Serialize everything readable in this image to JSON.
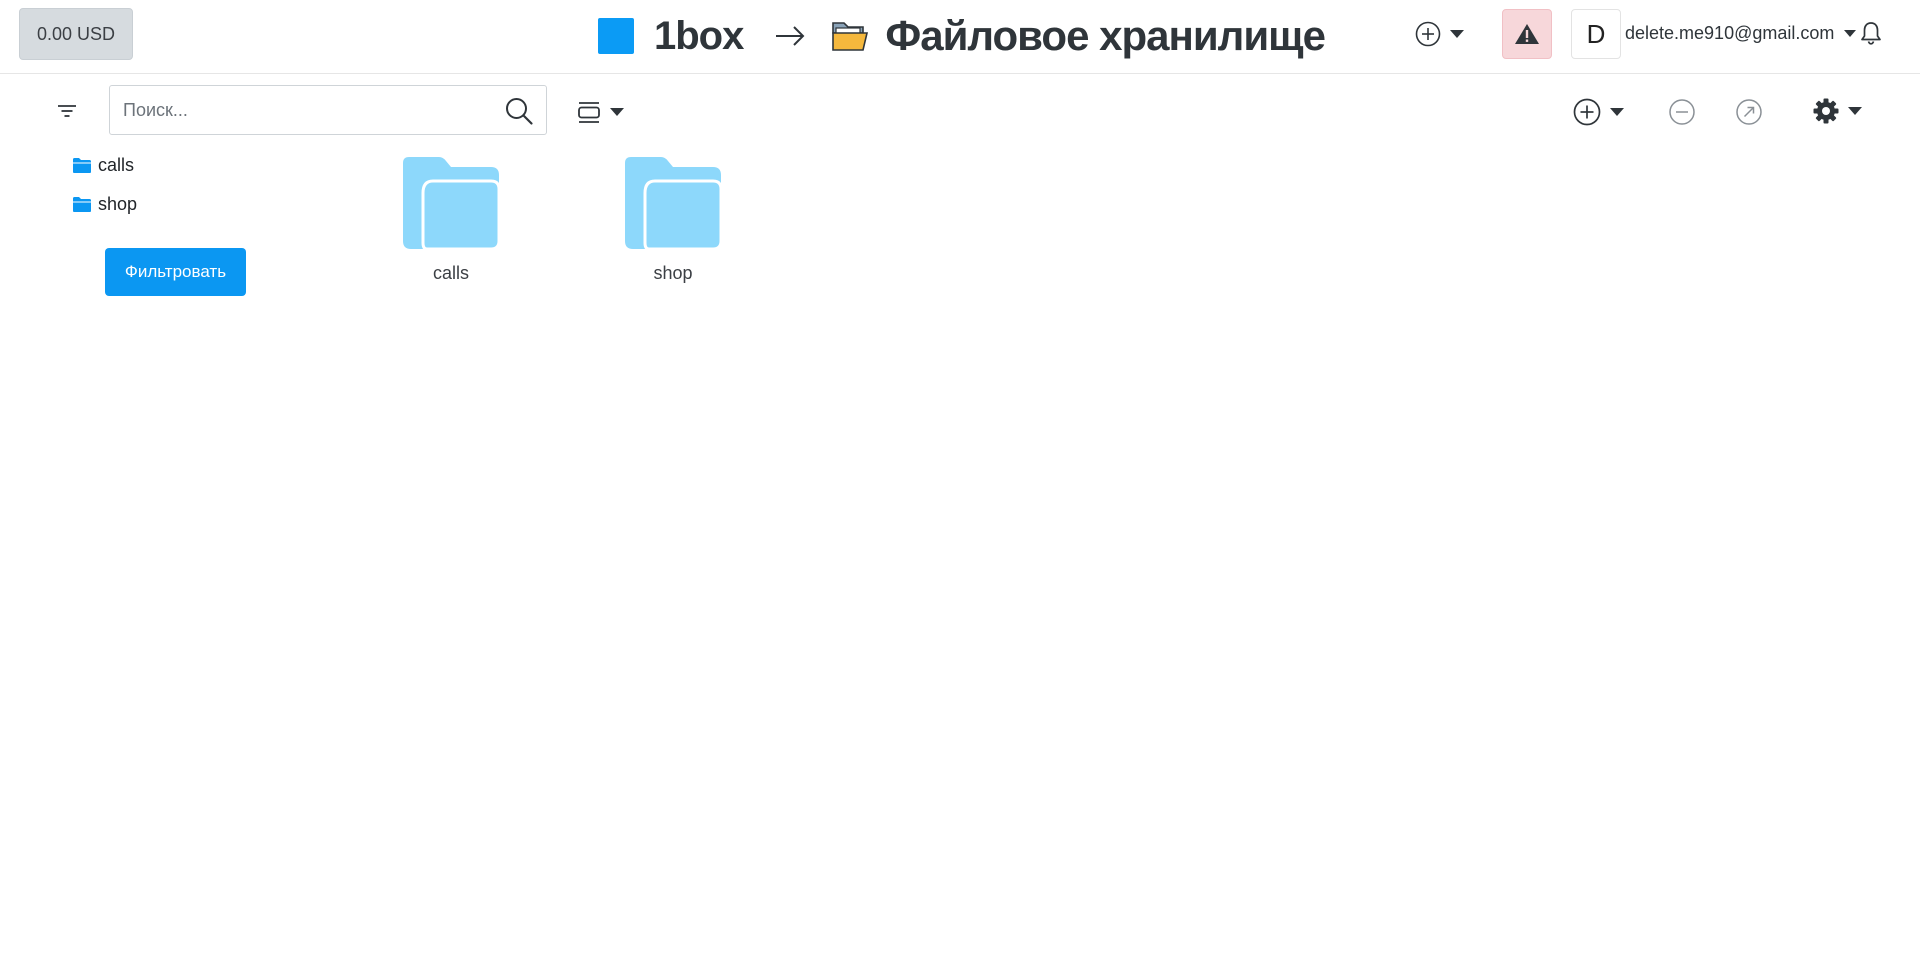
{
  "header": {
    "balance": "0.00 USD",
    "brand_name": "1box",
    "page_title": "Файловое хранилище",
    "avatar_letter": "D",
    "account_email": "delete.me910@gmail.com",
    "icons": [
      "add-circle-icon",
      "alert-triangle-icon",
      "bell-icon",
      "arrow-right-icon",
      "folder-open-icon"
    ]
  },
  "toolbar": {
    "search_placeholder": "Поиск...",
    "search_value": "",
    "icons": [
      "filter-lines-icon",
      "search-icon",
      "view-list-icon",
      "add-circle-icon",
      "remove-circle-icon",
      "share-circle-icon",
      "gear-icon"
    ]
  },
  "sidebar": {
    "items": [
      {
        "label": "calls"
      },
      {
        "label": "shop"
      }
    ],
    "filter_button": "Фильтровать"
  },
  "folders": [
    {
      "name": "calls"
    },
    {
      "name": "shop"
    }
  ],
  "colors": {
    "accent": "#0b97f2",
    "folder_fill": "#8dd8fb",
    "alert_bg": "#f7d7da",
    "balance_bg": "#d6dbdf"
  }
}
